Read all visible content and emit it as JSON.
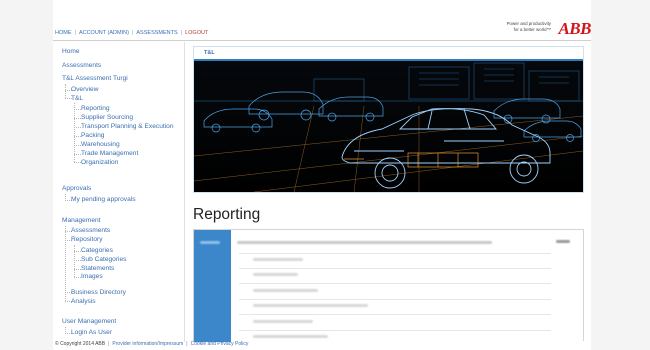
{
  "topnav": {
    "home": "HOME",
    "account": "ACCOUNT (ADMIN)",
    "assessments": "ASSESSMENTS",
    "logout": "LOGOUT",
    "separator": "|"
  },
  "brand": {
    "tagline_line1": "Power and productivity",
    "tagline_line2": "for a better world™",
    "logo": "ABB"
  },
  "sidebar": {
    "home": "Home",
    "assessments": "Assessments",
    "current_assessment": "T&L Assessment Turgi",
    "overview": "Overview",
    "tl": "T&L",
    "tl_items": [
      "Reporting",
      "Supplier Sourcing",
      "Transport Planning & Execution",
      "Packing",
      "Warehousing",
      "Trade Management",
      "Organization"
    ],
    "approvals": "Approvals",
    "pending_approvals": "My pending approvals",
    "management": "Management",
    "management_assessments": "Assessments",
    "repository": "Repository",
    "repository_items": [
      "Categories",
      "Sub Categories",
      "Statements",
      "Images"
    ],
    "business_directory": "Business Directory",
    "analysis": "Analysis",
    "user_management": "User Management",
    "login_as_user": "Login As User"
  },
  "main": {
    "panel_tab": "T&L",
    "title": "Reporting"
  },
  "footer": {
    "copyright": "© Copyright 2014 ABB",
    "provider": "Provider information/Impressum",
    "cookie": "Cookie and Privacy Policy",
    "separator": "|"
  },
  "colors": {
    "link": "#3a6fb0",
    "brand_red": "#d2141a",
    "accent_blue": "#2f7fc0",
    "report_side": "#3b87c9"
  }
}
